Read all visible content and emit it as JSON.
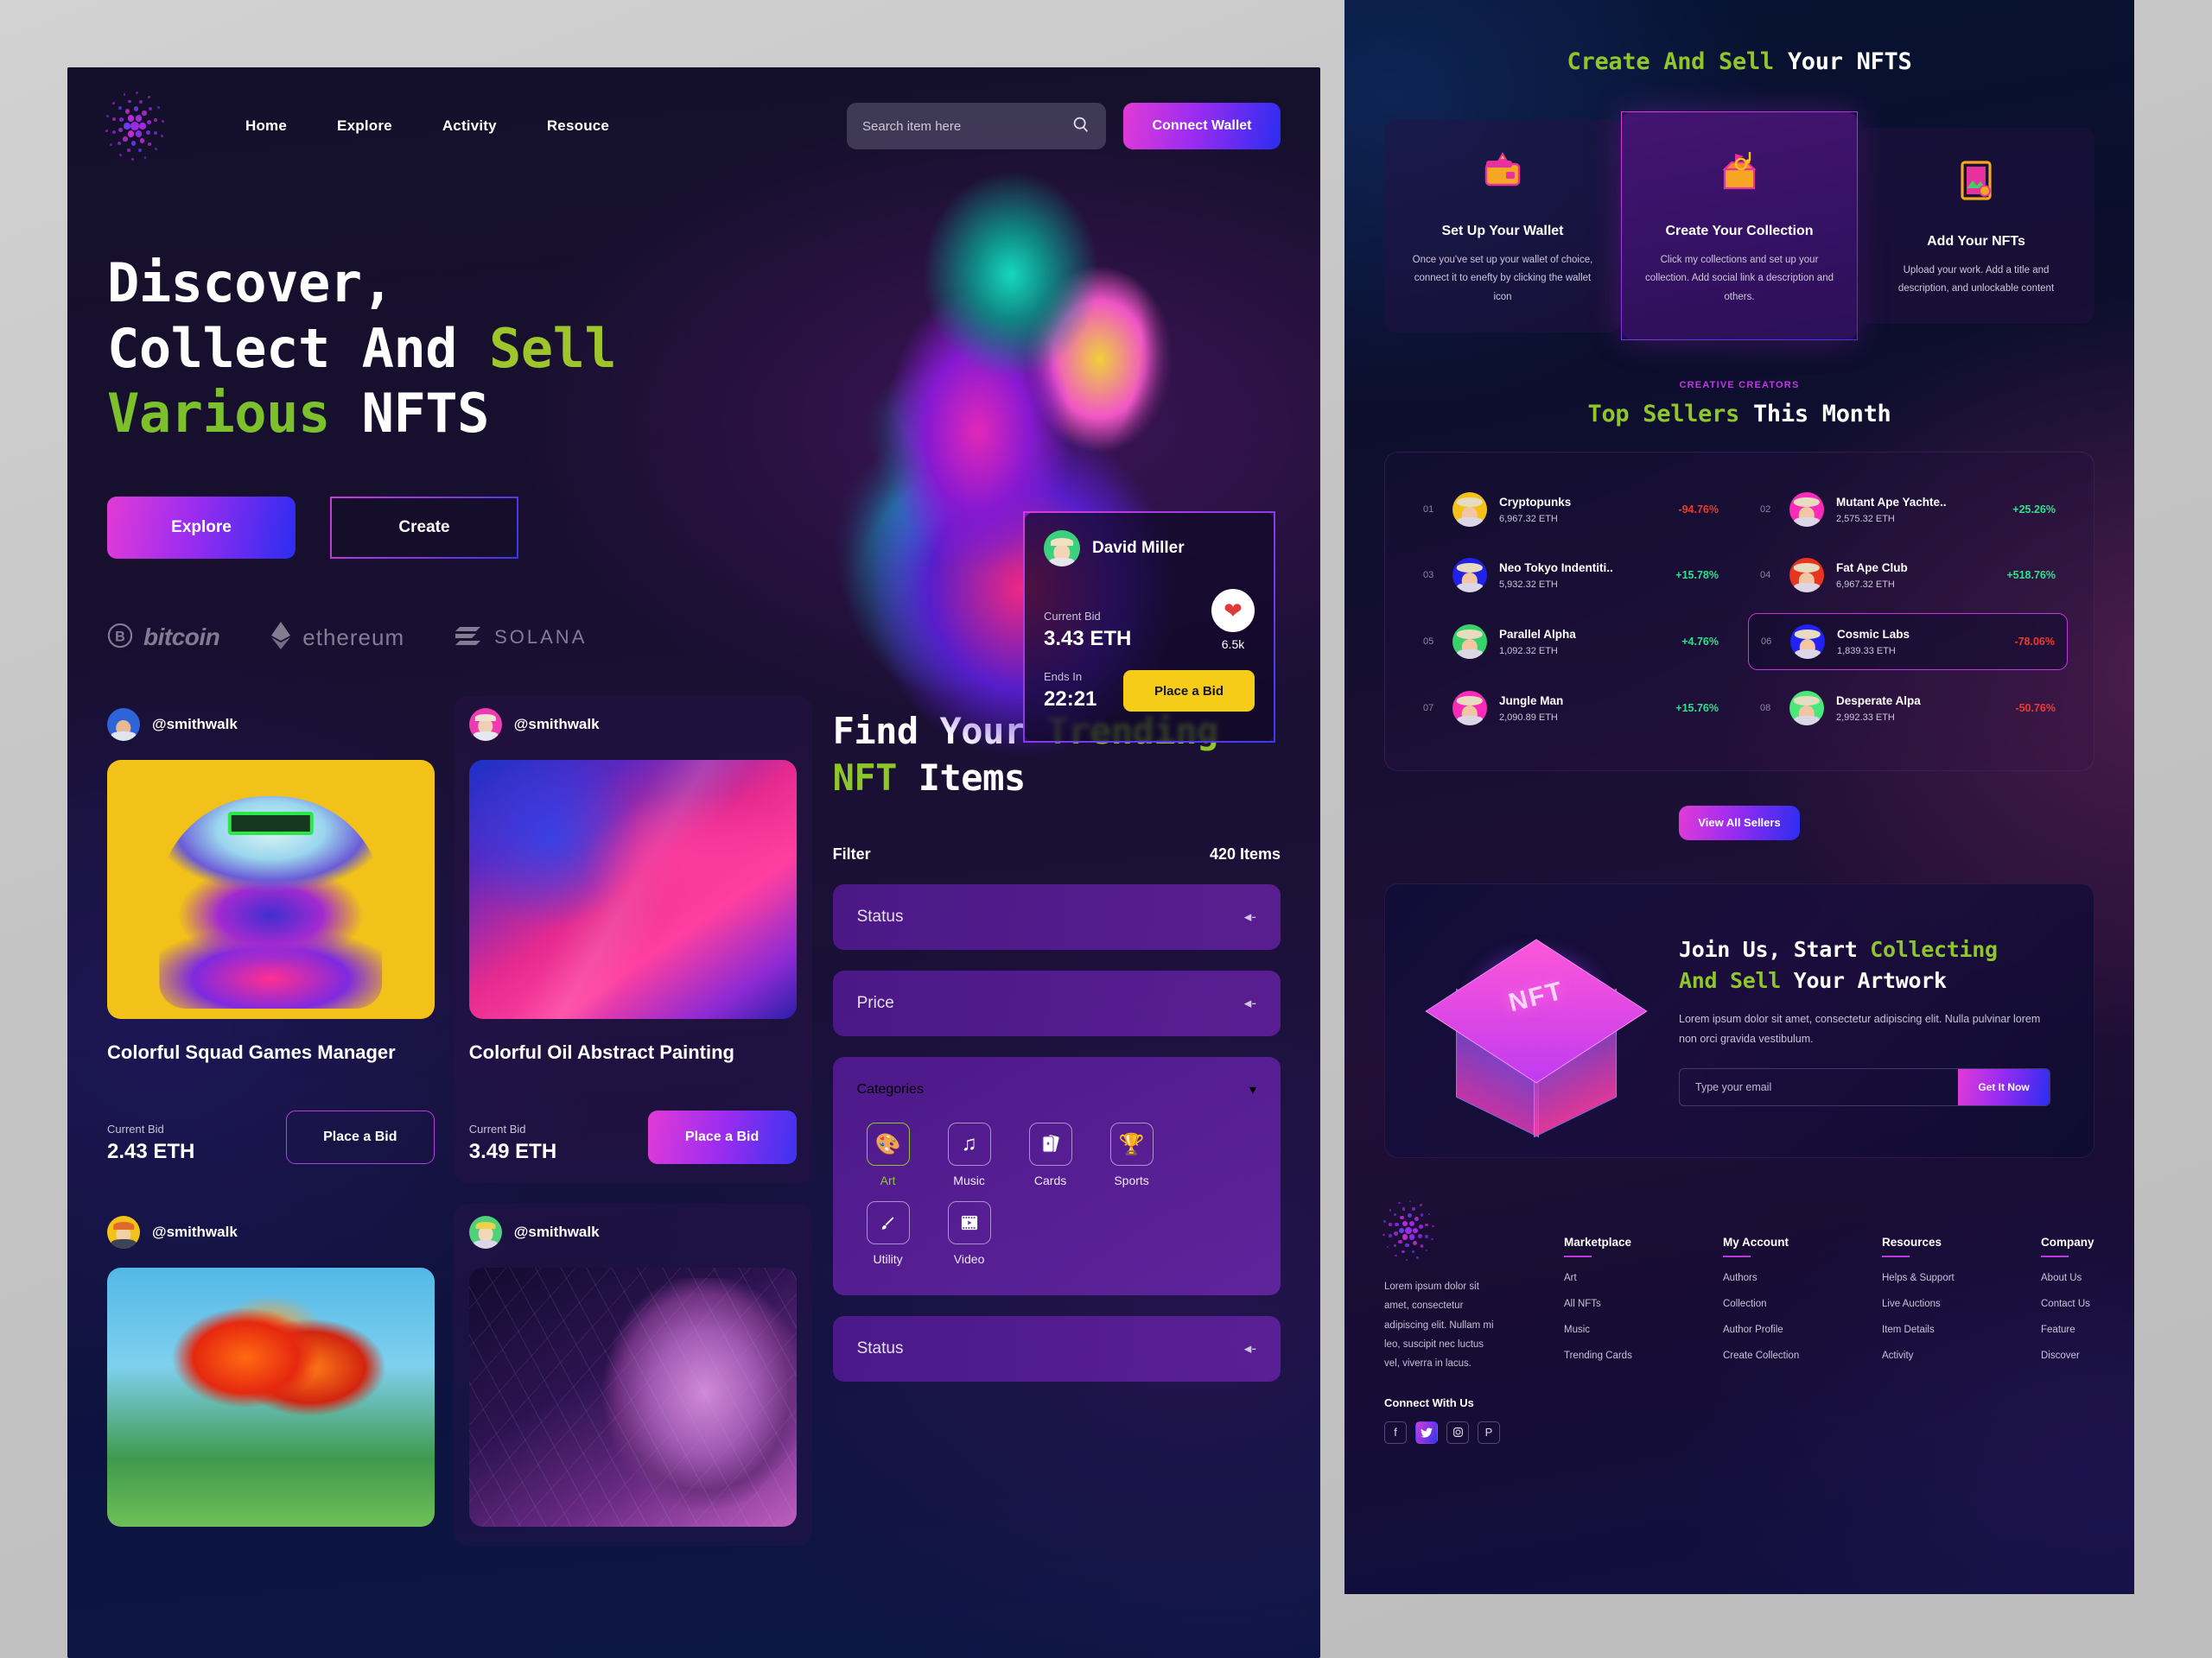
{
  "nav": {
    "links": [
      "Home",
      "Explore",
      "Activity",
      "Resouce"
    ],
    "search_placeholder": "Search item here",
    "search_value": "",
    "search_icon": "search-icon",
    "connect_label": "Connect Wallet"
  },
  "hero": {
    "line1": "Discover,",
    "line2a": "Collect And ",
    "line2b": "Sell",
    "line3a": "Various",
    "line3b": " NFTS",
    "explore_label": "Explore",
    "create_label": "Create",
    "coins": [
      {
        "name": "bitcoin",
        "icon": "bitcoin-icon"
      },
      {
        "name": "ethereum",
        "icon": "ethereum-icon"
      },
      {
        "name": "SOLANA",
        "icon": "solana-icon"
      }
    ]
  },
  "bid_card": {
    "user": "David Miller",
    "current_bid_label": "Current Bid",
    "current_bid": "3.43 ETH",
    "likes": "6.5k",
    "ends_label": "Ends In",
    "ends_in": "22:21",
    "cta": "Place a Bid"
  },
  "nft_cards": [
    {
      "handle": "@smithwalk",
      "title": "Colorful Squad Games Manager",
      "bid_label": "Current Bid",
      "bid": "2.43 ETH",
      "cta": "Place a Bid",
      "thumb": "squad-games-thumb",
      "avatar_color": "#2f63d8"
    },
    {
      "handle": "@smithwalk",
      "title": "Colorful Oil Abstract Painting",
      "bid_label": "Current Bid",
      "bid": "3.49 ETH",
      "cta": "Place a Bid",
      "thumb": "oil-abstract-thumb",
      "avatar_color": "#ef3bb0"
    },
    {
      "handle": "@smithwalk",
      "title": "",
      "bid_label": "",
      "bid": "",
      "cta": "",
      "thumb": "autumn-tree-thumb",
      "avatar_color": "#f2c21a"
    },
    {
      "handle": "@smithwalk",
      "title": "",
      "bid_label": "",
      "bid": "",
      "cta": "",
      "thumb": "geometric-face-thumb",
      "avatar_color": "#4fd07a"
    }
  ],
  "trending": {
    "title_a": "Find Your ",
    "title_b": "Trending",
    "title_c": "NFT",
    "title_d": " Items",
    "filter_label": "Filter",
    "items_count": "420 Items",
    "rows": [
      {
        "label": "Status",
        "icon": "chevron-left-icon"
      },
      {
        "label": "Price",
        "icon": "chevron-left-icon"
      }
    ],
    "categories_label": "Categories",
    "categories_icon": "chevron-down-icon",
    "categories": [
      {
        "label": "Art",
        "icon": "palette-icon",
        "active": true
      },
      {
        "label": "Music",
        "icon": "music-note-icon",
        "active": false
      },
      {
        "label": "Cards",
        "icon": "playing-cards-icon",
        "active": false
      },
      {
        "label": "Sports",
        "icon": "trophy-icon",
        "active": false
      },
      {
        "label": "Utility",
        "icon": "brush-icon",
        "active": false
      },
      {
        "label": "Video",
        "icon": "film-icon",
        "active": false
      }
    ],
    "bottom_row": {
      "label": "Status",
      "icon": "chevron-left-icon"
    }
  },
  "create_sell": {
    "title_a": "Create And Sell",
    "title_b": " Your NFTS",
    "steps": [
      {
        "icon": "wallet-icon",
        "title": "Set Up Your Wallet",
        "desc": "Once you've set up your wallet of choice, connect it to enefty by clicking the wallet icon",
        "highlighted": false
      },
      {
        "icon": "open-box-icon",
        "title": "Create Your Collection",
        "desc": "Click my collections and set up your collection. Add social link a description and others.",
        "highlighted": true
      },
      {
        "icon": "framed-art-icon",
        "title": "Add Your NFTs",
        "desc": "Upload your work. Add a title and description, and unlockable content",
        "highlighted": false
      }
    ]
  },
  "top_sellers": {
    "eyebrow": "CREATIVE CREATORS",
    "title_a": "Top Sellers",
    "title_b": " This Month",
    "view_all_label": "View All Sellers",
    "sellers": [
      {
        "rank": "01",
        "name": "Cryptopunks",
        "eth": "6,967.32 ETH",
        "pct": "-94.76%",
        "dir": "down",
        "color": "#f2c21a",
        "highlighted": false
      },
      {
        "rank": "02",
        "name": "Mutant Ape Yachte..",
        "eth": "2,575.32 ETH",
        "pct": "+25.26%",
        "dir": "up",
        "color": "#f92bb8",
        "highlighted": false
      },
      {
        "rank": "03",
        "name": "Neo Tokyo Indentiti..",
        "eth": "5,932.32 ETH",
        "pct": "+15.78%",
        "dir": "up",
        "color": "#2222e6",
        "highlighted": false
      },
      {
        "rank": "04",
        "name": "Fat Ape Club",
        "eth": "6,967.32 ETH",
        "pct": "+518.76%",
        "dir": "up",
        "color": "#e8351f",
        "highlighted": false
      },
      {
        "rank": "05",
        "name": "Parallel Alpha",
        "eth": "1,092.32 ETH",
        "pct": "+4.76%",
        "dir": "up",
        "color": "#35d36a",
        "highlighted": false
      },
      {
        "rank": "06",
        "name": "Cosmic Labs",
        "eth": "1,839.33 ETH",
        "pct": "-78.06%",
        "dir": "down",
        "color": "#2222f5",
        "highlighted": true
      },
      {
        "rank": "07",
        "name": "Jungle Man",
        "eth": "2,090.89 ETH",
        "pct": "+15.76%",
        "dir": "up",
        "color": "#f92bb8",
        "highlighted": false
      },
      {
        "rank": "08",
        "name": "Desperate Alpa",
        "eth": "2,992.33 ETH",
        "pct": "-50.76%",
        "dir": "down",
        "color": "#49e87a",
        "highlighted": false
      }
    ]
  },
  "join": {
    "title_a": "Join Us, Start ",
    "title_b": "Collecting",
    "title_c": "And Sell",
    "title_d": " Your Artwork",
    "paragraph": "Lorem ipsum dolor sit amet, consectetur adipiscing elit. Nulla pulvinar lorem non orci gravida vestibulum.",
    "email_placeholder": "Type your email",
    "email_value": "",
    "cta": "Get It Now",
    "cube_label": "NFT"
  },
  "footer": {
    "about": "Lorem ipsum dolor sit amet, consectetur adipiscing elit. Nullam mi leo, suscipit nec luctus vel, viverra in lacus.",
    "connect_title": "Connect With Us",
    "socials": [
      {
        "name": "facebook-icon",
        "glyph": "f"
      },
      {
        "name": "twitter-icon",
        "glyph": "ᵗ"
      },
      {
        "name": "instagram-icon",
        "glyph": "▢"
      },
      {
        "name": "pinterest-icon",
        "glyph": "P"
      }
    ],
    "columns": [
      {
        "heading": "Marketplace",
        "links": [
          "Art",
          "All NFTs",
          "Music",
          "Trending Cards"
        ]
      },
      {
        "heading": "My Account",
        "links": [
          "Authors",
          "Collection",
          "Author Profile",
          "Create Collection"
        ]
      },
      {
        "heading": "Resources",
        "links": [
          "Helps & Support",
          "Live Auctions",
          "Item Details",
          "Activity"
        ]
      },
      {
        "heading": "Company",
        "links": [
          "About Us",
          "Contact Us",
          "Feature",
          "Discover"
        ]
      }
    ]
  },
  "colors": {
    "accent_green": "#8ec62c",
    "accent_magenta": "#e23bd6",
    "accent_blue": "#2a2df0",
    "yellow_cta": "#f5cd18",
    "up_green": "#2fe08a",
    "down_red": "#ea3b2e"
  }
}
